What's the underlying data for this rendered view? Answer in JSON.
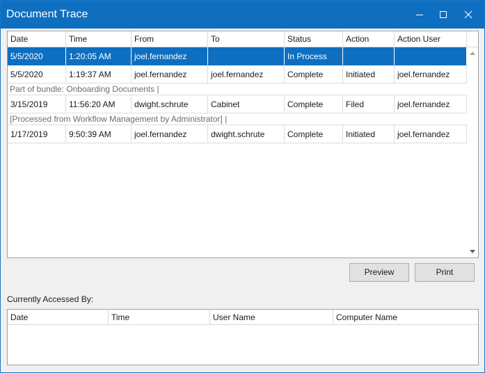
{
  "window": {
    "title": "Document Trace",
    "controls": [
      "minimize-icon",
      "maximize-icon",
      "close-icon"
    ]
  },
  "trace": {
    "columns": [
      "Date",
      "Time",
      "From",
      "To",
      "Status",
      "Action",
      "Action User"
    ],
    "rows": [
      {
        "date": "5/5/2020",
        "time": "1:20:05 AM",
        "from": "joel.fernandez",
        "to": "",
        "status": "In Process",
        "action": "",
        "user": ""
      },
      {
        "date": "5/5/2020",
        "time": "1:19:37 AM",
        "from": "joel.fernandez",
        "to": "joel.fernandez",
        "status": "Complete",
        "action": "Initiated",
        "user": "joel.fernandez"
      },
      {
        "date": "3/15/2019",
        "time": "11:56:20 AM",
        "from": "dwight.schrute",
        "to": "Cabinet",
        "status": "Complete",
        "action": "Filed",
        "user": "joel.fernandez"
      },
      {
        "date": "1/17/2019",
        "time": "9:50:39 AM",
        "from": "joel.fernandez",
        "to": "dwight.schrute",
        "status": "Complete",
        "action": "Initiated",
        "user": "joel.fernandez"
      }
    ],
    "notes": [
      "Part of bundle: Onboarding Documents |",
      "[Processed from Workflow Management by Administrator]  |"
    ]
  },
  "buttons": {
    "preview": "Preview",
    "print": "Print"
  },
  "accessed": {
    "label": "Currently Accessed By:",
    "columns": [
      "Date",
      "Time",
      "User Name",
      "Computer Name"
    ]
  },
  "colors": {
    "accent": "#0e6fc1",
    "background": "#f0f0f0"
  }
}
